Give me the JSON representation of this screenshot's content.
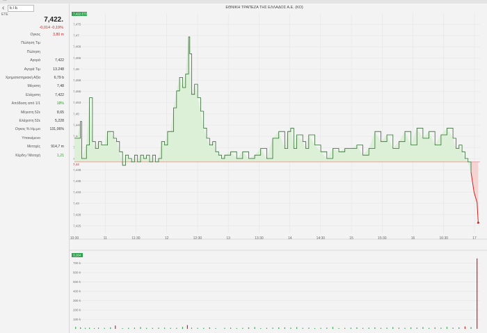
{
  "topbar": {
    "nav_text": "..."
  },
  "search": {
    "value": "ΕΤΕ"
  },
  "symbol": "ΕΤΕ",
  "quote": {
    "price": "7,422.",
    "change": "-0,014 -0,19%"
  },
  "stats": [
    {
      "label": "Ογκος",
      "value": "3,80 m",
      "value_color": "red"
    },
    {
      "label": "Πώληση Τιμ",
      "value": ""
    },
    {
      "label": "Πώληση",
      "value": ""
    },
    {
      "label": "Αγορά",
      "value": "7,422"
    },
    {
      "label": "Αγορά Τιμ",
      "value": "13.248"
    },
    {
      "label": "Χρηματιστηριακή Αξία",
      "value": "6,79 b"
    },
    {
      "label": "Μέγιστη",
      "value": "7,48"
    },
    {
      "label": "Ελάχιστη",
      "value": "7,422"
    },
    {
      "label": "Απόδοση από 1/1",
      "value": "18%",
      "value_color": "green"
    },
    {
      "label": "Μέγιστη 52ε",
      "value": "8,65"
    },
    {
      "label": "Ελάχιστη 52ε",
      "value": "5,228"
    },
    {
      "label": "Ογκος % Ημ.μο",
      "value": "131,06%"
    },
    {
      "label": "Υποκείμενο",
      "value": ""
    },
    {
      "label": "Μετοχές",
      "value": "914,7 m"
    },
    {
      "label": "Κέρδη / Μετοχή",
      "value": "1,21",
      "value_color": "green"
    }
  ],
  "chart_data": {
    "type": "area",
    "title": "ΕΘΝΙΚΗ ΤΡΑΠΕΖΑ ΤΗΣ ΕΛΛΑΔΟΣ Α.Ε. (ΚΟ)",
    "series_label": "7,422 ΕΤΕ",
    "volume_label": "3,164",
    "reference_price": 7.44,
    "reference_label": "7,44",
    "last_price": 7.422,
    "ylim": [
      7.419,
      7.484
    ],
    "y_ticks": [
      "7,475",
      "7,47",
      "7,468",
      "7,465",
      "7,46",
      "7,458",
      "7,455",
      "7,453",
      "7,45",
      "7,448",
      "7,445",
      "7,443",
      "7,44",
      "7,438",
      "7,435",
      "7,433",
      "7,43",
      "7,428",
      "7,425"
    ],
    "x_ticks": [
      "10:30",
      "11",
      "11:30",
      "12",
      "12:30",
      "13",
      "13:30",
      "14",
      "14:30",
      "15",
      "15:30",
      "16",
      "16:30",
      "17"
    ],
    "x_range_hours": [
      10.5,
      17.25
    ],
    "price_points": [
      [
        10.5,
        7.447
      ],
      [
        10.55,
        7.447
      ],
      [
        10.6,
        7.452
      ],
      [
        10.62,
        7.441
      ],
      [
        10.7,
        7.445
      ],
      [
        10.75,
        7.459
      ],
      [
        10.8,
        7.446
      ],
      [
        10.85,
        7.444
      ],
      [
        10.9,
        7.446
      ],
      [
        10.95,
        7.445
      ],
      [
        11.0,
        7.445
      ],
      [
        11.05,
        7.449
      ],
      [
        11.1,
        7.449
      ],
      [
        11.15,
        7.447
      ],
      [
        11.2,
        7.446
      ],
      [
        11.25,
        7.443
      ],
      [
        11.3,
        7.439
      ],
      [
        11.35,
        7.442
      ],
      [
        11.4,
        7.441
      ],
      [
        11.45,
        7.44
      ],
      [
        11.5,
        7.442
      ],
      [
        11.55,
        7.44
      ],
      [
        11.6,
        7.442
      ],
      [
        11.65,
        7.441
      ],
      [
        11.7,
        7.442
      ],
      [
        11.75,
        7.44
      ],
      [
        11.8,
        7.442
      ],
      [
        11.85,
        7.44
      ],
      [
        11.9,
        7.441
      ],
      [
        11.95,
        7.446
      ],
      [
        12.0,
        7.445
      ],
      [
        12.05,
        7.449
      ],
      [
        12.1,
        7.449
      ],
      [
        12.15,
        7.456
      ],
      [
        12.2,
        7.461
      ],
      [
        12.25,
        7.465
      ],
      [
        12.3,
        7.462
      ],
      [
        12.35,
        7.466
      ],
      [
        12.4,
        7.477
      ],
      [
        12.42,
        7.472
      ],
      [
        12.45,
        7.46
      ],
      [
        12.5,
        7.463
      ],
      [
        12.55,
        7.459
      ],
      [
        12.6,
        7.455
      ],
      [
        12.65,
        7.45
      ],
      [
        12.7,
        7.447
      ],
      [
        12.75,
        7.445
      ],
      [
        12.8,
        7.446
      ],
      [
        12.85,
        7.443
      ],
      [
        12.9,
        7.442
      ],
      [
        12.95,
        7.441
      ],
      [
        13.0,
        7.442
      ],
      [
        13.1,
        7.443
      ],
      [
        13.2,
        7.441
      ],
      [
        13.3,
        7.443
      ],
      [
        13.4,
        7.441
      ],
      [
        13.5,
        7.442
      ],
      [
        13.6,
        7.444
      ],
      [
        13.7,
        7.441
      ],
      [
        13.8,
        7.447
      ],
      [
        13.9,
        7.449
      ],
      [
        14.0,
        7.444
      ],
      [
        14.05,
        7.449
      ],
      [
        14.1,
        7.45
      ],
      [
        14.15,
        7.444
      ],
      [
        14.2,
        7.448
      ],
      [
        14.3,
        7.446
      ],
      [
        14.35,
        7.444
      ],
      [
        14.4,
        7.448
      ],
      [
        14.5,
        7.445
      ],
      [
        14.6,
        7.443
      ],
      [
        14.7,
        7.441
      ],
      [
        14.8,
        7.444
      ],
      [
        14.9,
        7.443
      ],
      [
        15.0,
        7.444
      ],
      [
        15.1,
        7.444
      ],
      [
        15.2,
        7.445
      ],
      [
        15.3,
        7.442
      ],
      [
        15.4,
        7.444
      ],
      [
        15.5,
        7.449
      ],
      [
        15.6,
        7.446
      ],
      [
        15.7,
        7.448
      ],
      [
        15.8,
        7.444
      ],
      [
        15.9,
        7.446
      ],
      [
        16.0,
        7.449
      ],
      [
        16.1,
        7.445
      ],
      [
        16.2,
        7.45
      ],
      [
        16.3,
        7.447
      ],
      [
        16.4,
        7.449
      ],
      [
        16.5,
        7.445
      ],
      [
        16.6,
        7.448
      ],
      [
        16.7,
        7.45
      ],
      [
        16.8,
        7.447
      ],
      [
        16.85,
        7.444
      ],
      [
        16.9,
        7.445
      ],
      [
        16.95,
        7.443
      ],
      [
        17.0,
        7.441
      ],
      [
        17.05,
        7.44
      ],
      [
        17.1,
        7.437
      ],
      [
        17.15,
        7.431
      ],
      [
        17.2,
        7.428
      ],
      [
        17.22,
        7.422
      ]
    ],
    "volume_ylim": [
      0,
      800000
    ],
    "volume_ticks": [
      "700 k",
      "600 k",
      "500 k",
      "400 k",
      "300 k",
      "200 k",
      "100 k"
    ],
    "volume_bars": [
      [
        10.52,
        20000,
        "g"
      ],
      [
        10.6,
        15000,
        "g"
      ],
      [
        10.68,
        10000,
        "g"
      ],
      [
        10.75,
        12000,
        "g"
      ],
      [
        10.83,
        8000,
        "g"
      ],
      [
        10.9,
        12000,
        "g"
      ],
      [
        11.0,
        10000,
        "g"
      ],
      [
        11.1,
        15000,
        "g"
      ],
      [
        11.18,
        35000,
        "r"
      ],
      [
        11.3,
        8000,
        "g"
      ],
      [
        11.4,
        10000,
        "g"
      ],
      [
        11.5,
        12000,
        "g"
      ],
      [
        11.6,
        18000,
        "g"
      ],
      [
        11.7,
        10000,
        "g"
      ],
      [
        11.8,
        10000,
        "g"
      ],
      [
        11.9,
        12000,
        "g"
      ],
      [
        12.0,
        12000,
        "g"
      ],
      [
        12.1,
        10000,
        "g"
      ],
      [
        12.2,
        10000,
        "g"
      ],
      [
        12.3,
        20000,
        "g"
      ],
      [
        12.38,
        40000,
        "r"
      ],
      [
        12.45,
        12000,
        "g"
      ],
      [
        12.55,
        10000,
        "g"
      ],
      [
        12.65,
        10000,
        "g"
      ],
      [
        12.75,
        15000,
        "g"
      ],
      [
        12.85,
        8000,
        "g"
      ],
      [
        13.0,
        10000,
        "g"
      ],
      [
        13.1,
        12000,
        "g"
      ],
      [
        13.2,
        8000,
        "g"
      ],
      [
        13.3,
        10000,
        "g"
      ],
      [
        13.4,
        15000,
        "g"
      ],
      [
        13.5,
        18000,
        "g"
      ],
      [
        13.6,
        8000,
        "g"
      ],
      [
        13.7,
        10000,
        "g"
      ],
      [
        13.8,
        12000,
        "g"
      ],
      [
        13.9,
        15000,
        "g"
      ],
      [
        14.0,
        15000,
        "g"
      ],
      [
        14.1,
        12000,
        "g"
      ],
      [
        14.2,
        18000,
        "g"
      ],
      [
        14.3,
        10000,
        "g"
      ],
      [
        14.4,
        12000,
        "g"
      ],
      [
        14.5,
        8000,
        "g"
      ],
      [
        14.6,
        10000,
        "g"
      ],
      [
        14.7,
        12000,
        "g"
      ],
      [
        14.8,
        20000,
        "g"
      ],
      [
        14.9,
        8000,
        "g"
      ],
      [
        15.0,
        10000,
        "g"
      ],
      [
        15.1,
        12000,
        "g"
      ],
      [
        15.2,
        15000,
        "g"
      ],
      [
        15.3,
        10000,
        "g"
      ],
      [
        15.4,
        12000,
        "g"
      ],
      [
        15.5,
        15000,
        "g"
      ],
      [
        15.6,
        10000,
        "g"
      ],
      [
        15.7,
        12000,
        "g"
      ],
      [
        15.8,
        18000,
        "g"
      ],
      [
        15.9,
        12000,
        "g"
      ],
      [
        16.0,
        10000,
        "g"
      ],
      [
        16.1,
        15000,
        "g"
      ],
      [
        16.2,
        12000,
        "g"
      ],
      [
        16.3,
        18000,
        "g"
      ],
      [
        16.4,
        10000,
        "g"
      ],
      [
        16.5,
        15000,
        "g"
      ],
      [
        16.6,
        12000,
        "g"
      ],
      [
        16.7,
        20000,
        "g"
      ],
      [
        16.8,
        12000,
        "g"
      ],
      [
        16.9,
        15000,
        "g"
      ],
      [
        17.0,
        25000,
        "r"
      ],
      [
        17.1,
        18000,
        "g"
      ],
      [
        17.2,
        750000,
        "r"
      ]
    ],
    "colors": {
      "line": "#2f6b2f",
      "fill": "#dcf0d8",
      "reference": "#e28a8a",
      "down_fill": "#f6d3d3",
      "down_line": "#d12020",
      "vol_green": "#2fa14f",
      "vol_red": "#d12020",
      "grid": "#e2e2e2",
      "label_bg": "#2fa14f"
    }
  }
}
